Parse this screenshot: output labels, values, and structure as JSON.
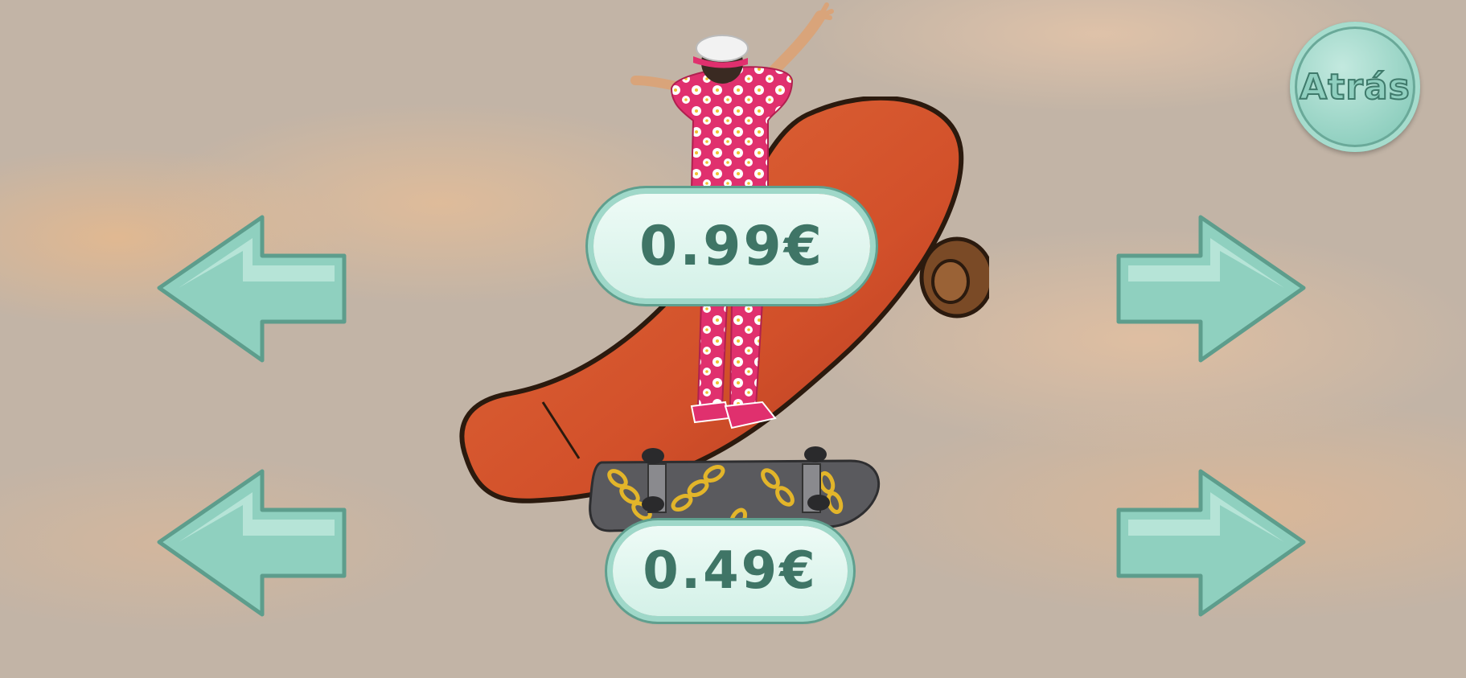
{
  "navigation": {
    "back_label": "Atrás"
  },
  "shop": {
    "outfit_price": "0.99€",
    "board_price": "0.49€"
  },
  "icons": {
    "arrow_left": "arrow-left-icon",
    "arrow_right": "arrow-right-icon"
  },
  "colors": {
    "accent": "#8fcfbf",
    "accent_dark": "#3f7566",
    "board": "#d9542e"
  }
}
